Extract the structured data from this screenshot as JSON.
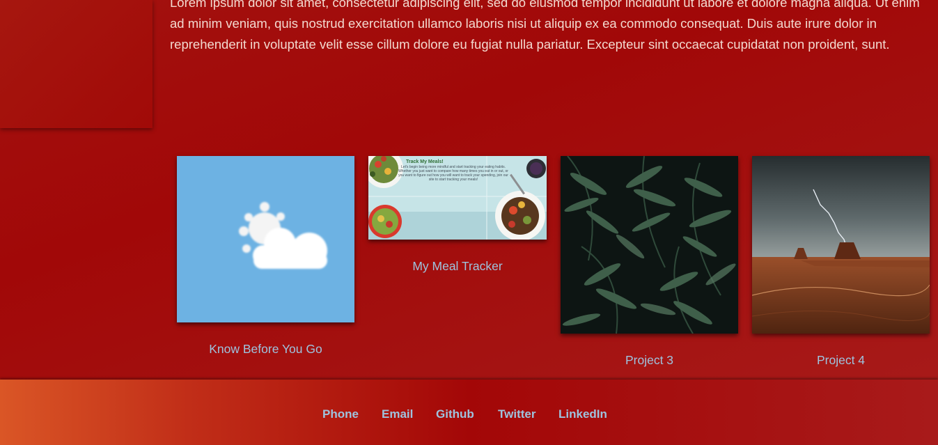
{
  "about": {
    "paragraph": "Lorem ipsum dolor sit amet, consectetur adipiscing elit, sed do eiusmod tempor incididunt ut labore et dolore magna aliqua. Ut enim ad minim veniam, quis nostrud exercitation ullamco laboris nisi ut aliquip ex ea commodo consequat. Duis aute irure dolor in reprehenderit in voluptate velit esse cillum dolore eu fugiat nulla pariatur. Excepteur sint occaecat cupidatat non proident, sunt."
  },
  "projects": [
    {
      "title": "Know Before You Go",
      "image": "weather-icon"
    },
    {
      "title": "My Meal Tracker",
      "image": "meal-tracker-screenshot",
      "screenshot_heading": "Track My Meals!",
      "screenshot_text": "Let's begin being more mindful and start tracking your eating habits. Whether you just want to compare how many times you eat in or out, or you want to figure out how you will want to track your spending, join our site to start tracking your meals!"
    },
    {
      "title": "Project 3",
      "image": "jungle-leaves-photo"
    },
    {
      "title": "Project 4",
      "image": "desert-lightning-photo"
    }
  ],
  "footer": {
    "links": [
      "Phone",
      "Email",
      "Github",
      "Twitter",
      "LinkedIn"
    ]
  },
  "colors": {
    "background": "#a10808",
    "link": "#9ec3de",
    "text": "#f3d9cf",
    "footer_start": "#da5626"
  }
}
